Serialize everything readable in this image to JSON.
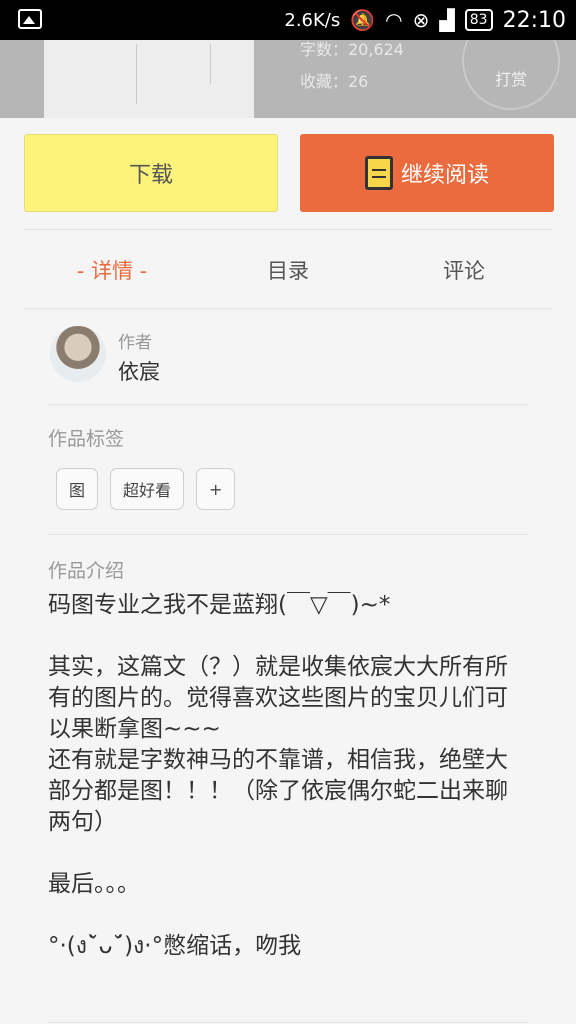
{
  "status_bar": {
    "net_speed": "2.6K/s",
    "battery": "83",
    "time": "22:10",
    "icons": [
      "gallery-icon",
      "mute-icon",
      "wifi-icon",
      "notification-icon",
      "signal-icon",
      "battery-icon"
    ]
  },
  "book": {
    "words_label": "字数：20,624",
    "favorites_label": "收藏：26",
    "reward_label": "打赏"
  },
  "actions": {
    "download": "下载",
    "continue_reading": "继续阅读"
  },
  "tabs": [
    {
      "label": "- 详情 -",
      "active": true
    },
    {
      "label": "目录",
      "active": false
    },
    {
      "label": "评论",
      "active": false
    }
  ],
  "author": {
    "label": "作者",
    "name": "依宸"
  },
  "tags_section": {
    "label": "作品标签",
    "tags": [
      "图",
      "超好看"
    ],
    "add": "+"
  },
  "intro_section": {
    "label": "作品介绍",
    "text": "码图专业之我不是蓝翔(￣▽￣)~*\n\n其实，这篇文（？）就是收集依宸大大所有所有的图片的。觉得喜欢这些图片的宝贝儿们可以果断拿图~~~\n还有就是字数神马的不靠谱，相信我，绝壁大部分都是图！！！（除了依宸偶尔蛇二出来聊两句）\n\n最后。。。\n\n°·(ง˘̀ᴗ˘́)ง·°憋缩话，吻我"
  },
  "colors": {
    "accent": "#ec6b3e",
    "download_bg": "#fcf47a"
  }
}
